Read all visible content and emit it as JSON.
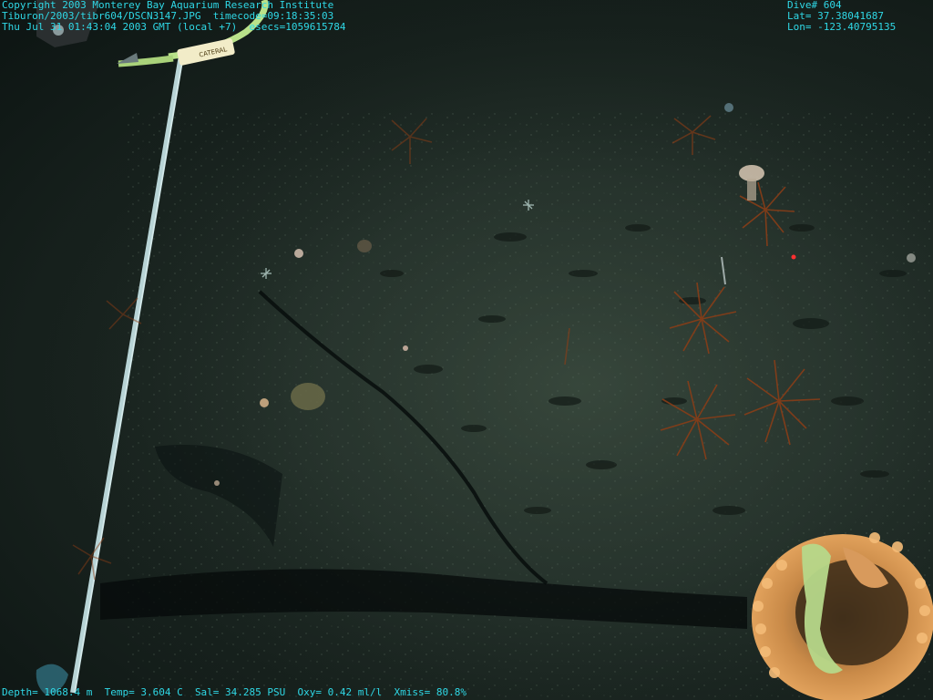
{
  "overlay": {
    "copyright": "Copyright 2003 Monterey Bay Aquarium Research Institute",
    "file_path": "Tiburon/2003/tibr604/DSCN3147.JPG",
    "timecode": "timecode=09:18:35:03",
    "datetime": "Thu Jul 31 01:43:04 2003 GMT (local +7)",
    "esecs": "esecs=1059615784",
    "dive": "Dive# 604",
    "lat": "Lat= 37.38041687",
    "lon": "Lon= -123.40795135",
    "depth": "Depth= 1068.4 m",
    "temp": "Temp= 3.604 C",
    "salinity": "Sal= 34.285 PSU",
    "oxygen": "Oxy= 0.42 ml/l",
    "transmissivity": "Xmiss= 80.8%"
  },
  "cable_tag": "CATERAL",
  "colors": {
    "overlay_text": "#2fd8e6",
    "seafloor": "#2b3830",
    "sponge": "#e8a45a",
    "crinoid": "#7a3a1a"
  }
}
